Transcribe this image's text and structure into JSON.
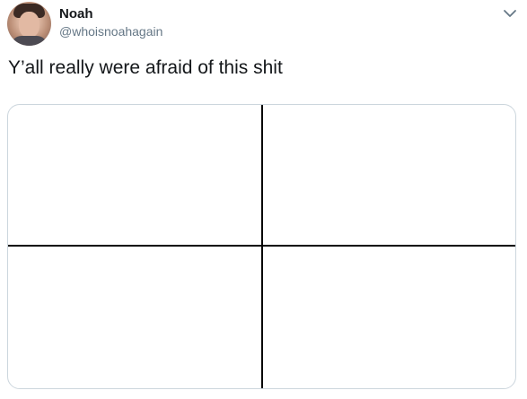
{
  "user": {
    "display_name": "Noah",
    "handle": "@whoisnoahagain",
    "avatar_icon": "profile-photo"
  },
  "tweet": {
    "text": "Y’all really were afraid of this shit",
    "more_icon": "chevron-down-icon"
  },
  "media": {
    "description_icon": "quadrant-grid-image"
  },
  "colors": {
    "text_primary": "#14171a",
    "text_secondary": "#657786",
    "border": "#ccd6dd",
    "grid_lines": "#000000"
  }
}
